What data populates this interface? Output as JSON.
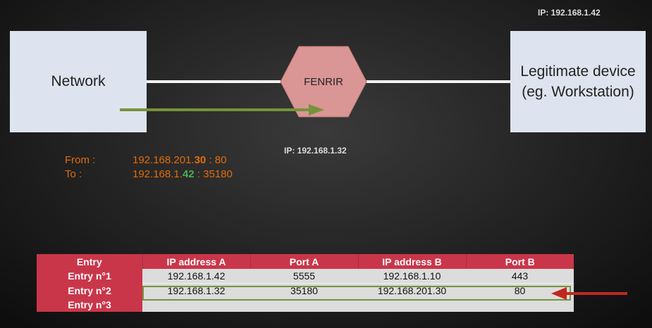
{
  "device_ip": "IP: 192.168.1.42",
  "network_label": "Network",
  "device_label_line1": "Legitimate device",
  "device_label_line2": "(eg. Workstation)",
  "fenrir_label": "FENRIR",
  "fenrir_ip": "IP: 192.168.1.32",
  "packet": {
    "from_label": "From :",
    "to_label": "To :",
    "from_prefix": "192.168.201.",
    "from_highlight": "30",
    "from_suffix": " : 80",
    "to_prefix": "192.168.1.",
    "to_highlight": "42",
    "to_suffix": " : 35180"
  },
  "colors": {
    "arrow_green": "#76923c",
    "arrow_red": "#c0281e",
    "hexagon": "#d99694",
    "table_header": "#c9364a",
    "highlight_orange": "#e36c0a",
    "highlight_green": "#4caf50"
  },
  "table": {
    "headers": [
      "Entry",
      "IP address A",
      "Port A",
      "IP address B",
      "Port B"
    ],
    "rows": [
      {
        "entry": "Entry n°1",
        "ip_a": "192.168.1.42",
        "port_a": "5555",
        "ip_b": "192.168.1.10",
        "port_b": "443"
      },
      {
        "entry": "Entry n°2",
        "ip_a": "192.168.1.32",
        "port_a": "35180",
        "ip_b": "192.168.201.30",
        "port_b": "80"
      },
      {
        "entry": "Entry n°3",
        "ip_a": "",
        "port_a": "",
        "ip_b": "",
        "port_b": ""
      }
    ]
  }
}
